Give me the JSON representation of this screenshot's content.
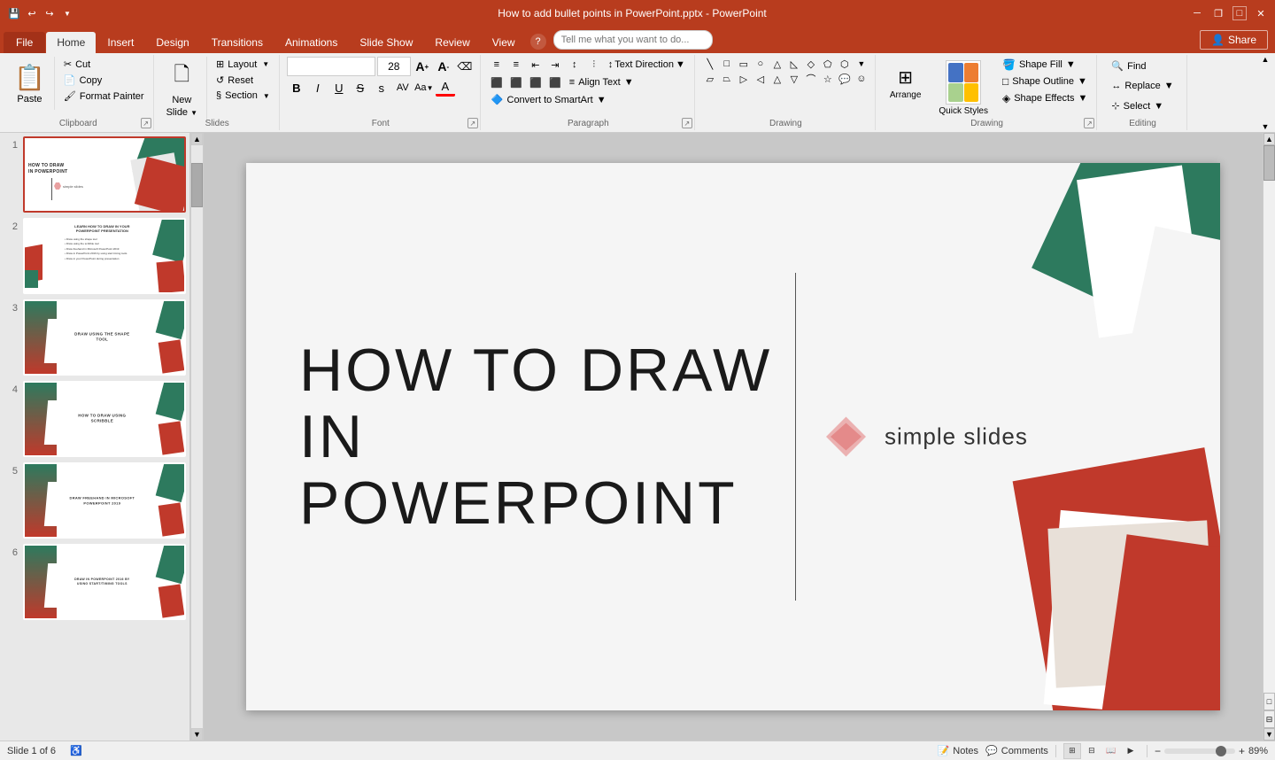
{
  "titleBar": {
    "title": "How to add bullet points in PowerPoint.pptx - PowerPoint",
    "quickAccessIcons": [
      "save",
      "undo",
      "redo",
      "customize"
    ],
    "windowControls": [
      "minimize",
      "restore",
      "maximize",
      "close"
    ]
  },
  "ribbonTabs": {
    "tabs": [
      "File",
      "Home",
      "Insert",
      "Design",
      "Transitions",
      "Animations",
      "Slide Show",
      "Review",
      "View"
    ],
    "activeTab": "Home",
    "tellMe": "Tell me what you want to do...",
    "shareLabel": "Share"
  },
  "ribbon": {
    "clipboard": {
      "label": "Clipboard",
      "paste": "Paste",
      "cut": "Cut",
      "copy": "Copy",
      "formatPainter": "Format Painter"
    },
    "slides": {
      "label": "Slides",
      "newSlide": "New Slide",
      "layout": "Layout",
      "reset": "Reset",
      "section": "Section"
    },
    "font": {
      "label": "Font",
      "fontFamily": "",
      "fontSize": "28",
      "bold": "B",
      "italic": "I",
      "underline": "U",
      "strikethrough": "S",
      "shadow": "s",
      "charSpacing": "AV",
      "changeCase": "Aa",
      "fontColor": "A",
      "increaseFont": "A↑",
      "decreaseFont": "A↓",
      "clearFormat": "A×"
    },
    "paragraph": {
      "label": "Paragraph",
      "textDirection": "Text Direction",
      "alignText": "Align Text",
      "convertSmartArt": "Convert to SmartArt",
      "bulletList": "≡",
      "numberedList": "≡",
      "decreaseIndent": "←",
      "increaseIndent": "→",
      "lineSpacing": "↕",
      "columns": "|||",
      "alignLeft": "⬛",
      "alignCenter": "⬛",
      "alignRight": "⬛",
      "justify": "⬛"
    },
    "drawing": {
      "label": "Drawing",
      "shapes": [
        "□",
        "○",
        "△",
        "◇",
        "⬟",
        "⬡",
        "⬢",
        "⬣",
        "⬤",
        "▭",
        "▱",
        "▲",
        "▼",
        "◁",
        "▷",
        "⬠",
        "⬡",
        "⬢",
        "⬣"
      ],
      "arrange": "Arrange",
      "quickStyles": "Quick Styles",
      "shapeFill": "Shape Fill",
      "shapeOutline": "Shape Outline",
      "shapeEffects": "Shape Effects"
    },
    "editing": {
      "label": "Editing",
      "find": "Find",
      "replace": "Replace",
      "select": "Select"
    }
  },
  "slides": [
    {
      "num": "1",
      "active": true,
      "title": "HOW TO DRAW IN POWERPOINT",
      "subtitle": "",
      "type": "title"
    },
    {
      "num": "2",
      "active": false,
      "title": "LEARN HOW TO DRAW IN YOUR POWERPOINT PRESENTATION",
      "subtitle": "• Draw using the shape tool\n• Draw using the scribble tool\n• Draw freehand in Microsoft PowerPoint 2019\n• Draw in PowerPoint 2016 by using start timing tools\n• Draw in your PowerPoint during presentation",
      "type": "content"
    },
    {
      "num": "3",
      "active": false,
      "title": "DRAW USING THE SHAPE TOOL",
      "subtitle": "",
      "type": "section"
    },
    {
      "num": "4",
      "active": false,
      "title": "HOW TO DRAW USING SCRIBBLE",
      "subtitle": "",
      "type": "section"
    },
    {
      "num": "5",
      "active": false,
      "title": "DRAW FREEHAND IN MICROSOFT POWERPOINT 2019",
      "subtitle": "",
      "type": "section"
    },
    {
      "num": "6",
      "active": false,
      "title": "DRAW IN POWERPOINT 2016 BY USING START/TIMING TOOLS",
      "subtitle": "",
      "type": "section"
    }
  ],
  "mainSlide": {
    "title1": "HOW TO DRAW",
    "title2": "IN POWERPOINT",
    "logoText": "simple slides"
  },
  "statusBar": {
    "slideInfo": "Slide 1 of 6",
    "notes": "Notes",
    "comments": "Comments",
    "zoom": "89%"
  }
}
